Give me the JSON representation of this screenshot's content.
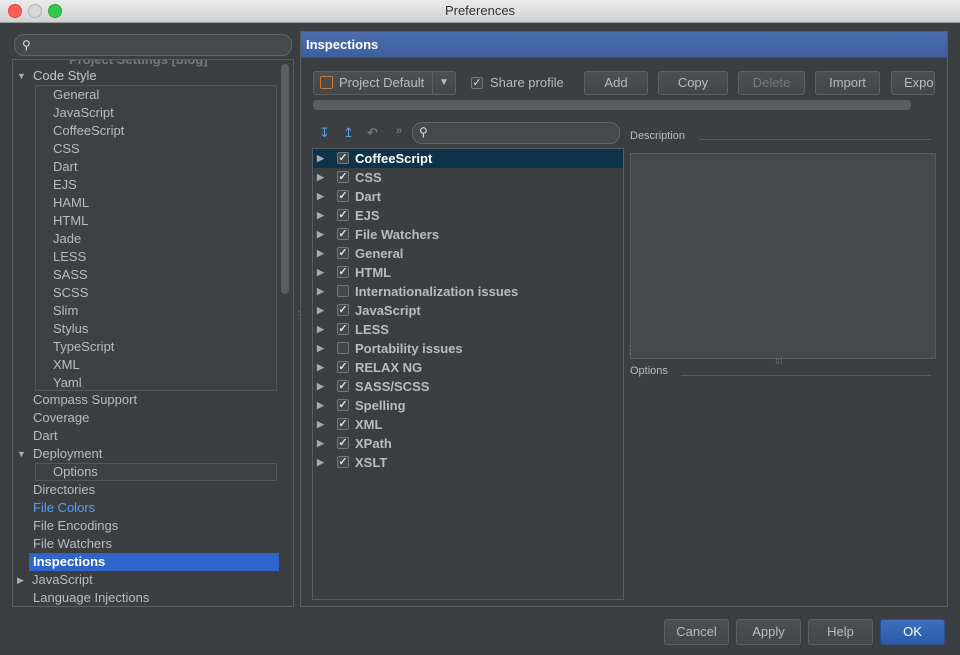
{
  "window": {
    "title": "Preferences"
  },
  "sidebar": {
    "ghost_label": "Project Settings [blog]",
    "code_style": {
      "label": "Code Style",
      "items": [
        "General",
        "JavaScript",
        "CoffeeScript",
        "CSS",
        "Dart",
        "EJS",
        "HAML",
        "HTML",
        "Jade",
        "LESS",
        "SASS",
        "SCSS",
        "Slim",
        "Stylus",
        "TypeScript",
        "XML",
        "Yaml"
      ]
    },
    "compass_support": "Compass Support",
    "coverage": "Coverage",
    "dart": "Dart",
    "deployment": {
      "label": "Deployment",
      "options": "Options"
    },
    "directories": "Directories",
    "file_colors": "File Colors",
    "file_encodings": "File Encodings",
    "file_watchers": "File Watchers",
    "inspections": "Inspections",
    "javascript": "JavaScript",
    "language_injections": "Language Injections"
  },
  "panel": {
    "header": "Inspections",
    "profile": "Project Default",
    "share_profile": "Share profile",
    "buttons": {
      "add": "Add",
      "copy": "Copy",
      "delete": "Delete",
      "import": "Import",
      "export": "Expo"
    },
    "description_label": "Description",
    "options_label": "Options",
    "inspections": [
      {
        "label": "CoffeeScript",
        "checked": true
      },
      {
        "label": "CSS",
        "checked": true
      },
      {
        "label": "Dart",
        "checked": true
      },
      {
        "label": "EJS",
        "checked": true
      },
      {
        "label": "File Watchers",
        "checked": true
      },
      {
        "label": "General",
        "checked": true
      },
      {
        "label": "HTML",
        "checked": true
      },
      {
        "label": "Internationalization issues",
        "checked": false
      },
      {
        "label": "JavaScript",
        "checked": true
      },
      {
        "label": "LESS",
        "checked": true
      },
      {
        "label": "Portability issues",
        "checked": false
      },
      {
        "label": "RELAX NG",
        "checked": true
      },
      {
        "label": "SASS/SCSS",
        "checked": true
      },
      {
        "label": "Spelling",
        "checked": true
      },
      {
        "label": "XML",
        "checked": true
      },
      {
        "label": "XPath",
        "checked": true
      },
      {
        "label": "XSLT",
        "checked": true
      }
    ]
  },
  "footer": {
    "cancel": "Cancel",
    "apply": "Apply",
    "help": "Help",
    "ok": "OK"
  }
}
